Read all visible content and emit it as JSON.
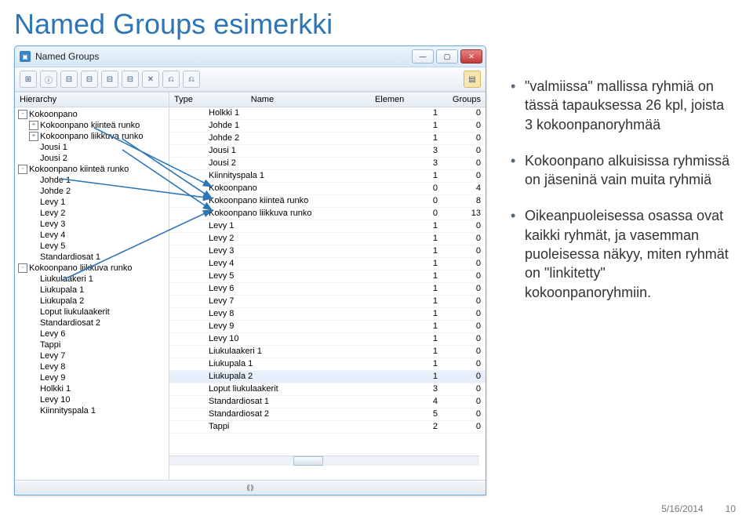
{
  "page": {
    "title": "Named Groups esimerkki"
  },
  "window": {
    "title": "Named Groups"
  },
  "toolbar": {
    "icons": [
      "⊞",
      "ⓘ",
      "⊟",
      "⊟",
      "⊟",
      "⊟",
      "✕",
      "⎌",
      "⎌",
      "⎯",
      "▤"
    ]
  },
  "left": {
    "header": "Hierarchy",
    "tree": [
      {
        "ind": 0,
        "tw": "-",
        "label": "Kokoonpano"
      },
      {
        "ind": 1,
        "tw": "+",
        "label": "Kokoonpano kiinteä runko"
      },
      {
        "ind": 1,
        "tw": "+",
        "label": "Kokoonpano liikkuva runko"
      },
      {
        "ind": 1,
        "tw": "",
        "label": "Jousi 1"
      },
      {
        "ind": 1,
        "tw": "",
        "label": "Jousi 2"
      },
      {
        "ind": 0,
        "tw": "-",
        "label": "Kokoonpano kiinteä runko"
      },
      {
        "ind": 1,
        "tw": "",
        "label": "Johde 1"
      },
      {
        "ind": 1,
        "tw": "",
        "label": "Johde 2"
      },
      {
        "ind": 1,
        "tw": "",
        "label": "Levy 1"
      },
      {
        "ind": 1,
        "tw": "",
        "label": "Levy 2"
      },
      {
        "ind": 1,
        "tw": "",
        "label": "Levy 3"
      },
      {
        "ind": 1,
        "tw": "",
        "label": "Levy 4"
      },
      {
        "ind": 1,
        "tw": "",
        "label": "Levy 5"
      },
      {
        "ind": 1,
        "tw": "",
        "label": "Standardiosat 1"
      },
      {
        "ind": 0,
        "tw": "-",
        "label": "Kokoonpano liikkuva runko"
      },
      {
        "ind": 1,
        "tw": "",
        "label": "Liukulaakeri 1"
      },
      {
        "ind": 1,
        "tw": "",
        "label": "Liukupala 1"
      },
      {
        "ind": 1,
        "tw": "",
        "label": "Liukupala 2"
      },
      {
        "ind": 1,
        "tw": "",
        "label": "Loput liukulaakerit"
      },
      {
        "ind": 1,
        "tw": "",
        "label": "Standardiosat 2"
      },
      {
        "ind": 1,
        "tw": "",
        "label": "Levy 6"
      },
      {
        "ind": 1,
        "tw": "",
        "label": "Tappi"
      },
      {
        "ind": 1,
        "tw": "",
        "label": "Levy 7"
      },
      {
        "ind": 1,
        "tw": "",
        "label": "Levy 8"
      },
      {
        "ind": 1,
        "tw": "",
        "label": "Levy 9"
      },
      {
        "ind": 1,
        "tw": "",
        "label": "Holkki 1"
      },
      {
        "ind": 1,
        "tw": "",
        "label": "Levy 10"
      },
      {
        "ind": 1,
        "tw": "",
        "label": "Kiinnityspala 1"
      }
    ]
  },
  "right": {
    "headers": {
      "type": "Type",
      "name": "Name",
      "elem": "Elemen",
      "groups": "Groups"
    },
    "rows": [
      {
        "name": "Holkki 1",
        "e": "1",
        "g": "0"
      },
      {
        "name": "Johde 1",
        "e": "1",
        "g": "0"
      },
      {
        "name": "Johde 2",
        "e": "1",
        "g": "0"
      },
      {
        "name": "Jousi 1",
        "e": "3",
        "g": "0"
      },
      {
        "name": "Jousi 2",
        "e": "3",
        "g": "0"
      },
      {
        "name": "Kiinnityspala 1",
        "e": "1",
        "g": "0"
      },
      {
        "name": "Kokoonpano",
        "e": "0",
        "g": "4"
      },
      {
        "name": "Kokoonpano kiinteä runko",
        "e": "0",
        "g": "8"
      },
      {
        "name": "Kokoonpano liikkuva runko",
        "e": "0",
        "g": "13"
      },
      {
        "name": "Levy 1",
        "e": "1",
        "g": "0"
      },
      {
        "name": "Levy 2",
        "e": "1",
        "g": "0"
      },
      {
        "name": "Levy 3",
        "e": "1",
        "g": "0"
      },
      {
        "name": "Levy 4",
        "e": "1",
        "g": "0"
      },
      {
        "name": "Levy 5",
        "e": "1",
        "g": "0"
      },
      {
        "name": "Levy 6",
        "e": "1",
        "g": "0"
      },
      {
        "name": "Levy 7",
        "e": "1",
        "g": "0"
      },
      {
        "name": "Levy 8",
        "e": "1",
        "g": "0"
      },
      {
        "name": "Levy 9",
        "e": "1",
        "g": "0"
      },
      {
        "name": "Levy 10",
        "e": "1",
        "g": "0"
      },
      {
        "name": "Liukulaakeri 1",
        "e": "1",
        "g": "0"
      },
      {
        "name": "Liukupala 1",
        "e": "1",
        "g": "0"
      },
      {
        "name": "Liukupala 2",
        "e": "1",
        "g": "0",
        "sel": true
      },
      {
        "name": "Loput liukulaakerit",
        "e": "3",
        "g": "0"
      },
      {
        "name": "Standardiosat 1",
        "e": "4",
        "g": "0"
      },
      {
        "name": "Standardiosat 2",
        "e": "5",
        "g": "0"
      },
      {
        "name": "Tappi",
        "e": "2",
        "g": "0"
      }
    ]
  },
  "bullets": {
    "items": [
      "\"valmiissa\" mallissa ryhmiä on tässä tapauksessa 26 kpl, joista 3 kokoonpanoryhmää",
      "Kokoonpano alkuisissa ryhmissä on jäseninä vain muita ryhmiä",
      "Oikeanpuoleisessa osassa ovat kaikki ryhmät, ja vasemman puoleisessa näkyy, miten ryhmät on \"linkitetty\" kokoonpanoryhmiin."
    ]
  },
  "footer": {
    "date": "5/16/2014",
    "page": "10"
  },
  "status": "⟪⟫"
}
